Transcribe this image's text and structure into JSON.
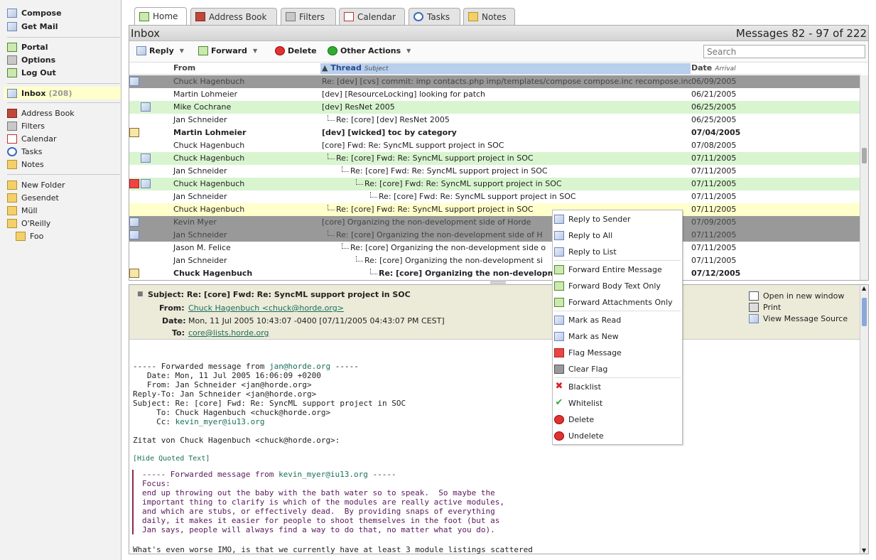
{
  "sidebar": {
    "compose": "Compose",
    "get_mail": "Get Mail",
    "portal": "Portal",
    "options": "Options",
    "logout": "Log Out",
    "inbox": "Inbox",
    "inbox_count": "(208)",
    "address_book": "Address Book",
    "filters": "Filters",
    "calendar": "Calendar",
    "tasks": "Tasks",
    "notes": "Notes",
    "new_folder": "New Folder",
    "folders": [
      "Gesendet",
      "Müll",
      "O'Reilly"
    ],
    "subfolder": "Foo"
  },
  "tabs": [
    "Home",
    "Address Book",
    "Filters",
    "Calendar",
    "Tasks",
    "Notes"
  ],
  "mailbox": {
    "title": "Inbox",
    "counter": "Messages 82 - 97 of 222",
    "search_placeholder": "Search"
  },
  "toolbar": {
    "reply": "Reply",
    "forward": "Forward",
    "delete": "Delete",
    "other_actions": "Other Actions"
  },
  "columns": {
    "from": "From",
    "thread": "Thread",
    "thread_sub": "Subject",
    "date": "Date",
    "date_sub": "Arrival"
  },
  "messages": [
    {
      "from": "Chuck Hagenbuch",
      "subject": "Re: [dev] [cvs] commit: imp contacts.php imp/templates/compose compose.inc recompose.inc",
      "date": "06/09/2005",
      "style": "deleted"
    },
    {
      "from": "Martin Lohmeier",
      "subject": "[dev] [ResourceLocking] looking for patch",
      "date": "06/21/2005",
      "style": ""
    },
    {
      "from": "Mike Cochrane",
      "subject": "[dev] ResNet 2005",
      "date": "06/25/2005",
      "style": "green"
    },
    {
      "from": "Jan Schneider",
      "subject": "Re: [core] [dev] ResNet 2005",
      "date": "06/25/2005",
      "style": ""
    },
    {
      "from": "Martin Lohmeier",
      "subject": "[dev] [wicked] toc by category",
      "date": "07/04/2005",
      "style": "unread"
    },
    {
      "from": "Chuck Hagenbuch",
      "subject": "[core] Fwd: Re: SyncML support project in SOC",
      "date": "07/08/2005",
      "style": ""
    },
    {
      "from": "Chuck Hagenbuch",
      "subject": "Re: [core] Fwd: Re: SyncML support project in SOC",
      "date": "07/11/2005",
      "style": "green"
    },
    {
      "from": "Jan Schneider",
      "subject": "Re: [core] Fwd: Re: SyncML support project in SOC",
      "date": "07/11/2005",
      "style": ""
    },
    {
      "from": "Chuck Hagenbuch",
      "subject": "Re: [core] Fwd: Re: SyncML support project in SOC",
      "date": "07/11/2005",
      "style": "green"
    },
    {
      "from": "Jan Schneider",
      "subject": "Re: [core] Fwd: Re: SyncML support project in SOC",
      "date": "07/11/2005",
      "style": ""
    },
    {
      "from": "Chuck Hagenbuch",
      "subject": "Re: [core] Fwd: Re: SyncML support project in SOC",
      "date": "07/11/2005",
      "style": "yellow"
    },
    {
      "from": "Kevin Myer",
      "subject": "[core] Organizing the non-development side of Horde",
      "date": "07/09/2005",
      "style": "deleted"
    },
    {
      "from": "Jan Schneider",
      "subject": "Re: [core] Organizing the non-development side of H",
      "date": "07/11/2005",
      "style": "deleted"
    },
    {
      "from": "Jason M. Felice",
      "subject": "Re: [core] Organizing the non-development side o",
      "date": "07/11/2005",
      "style": ""
    },
    {
      "from": "Jan Schneider",
      "subject": "Re: [core] Organizing the non-development si",
      "date": "07/11/2005",
      "style": ""
    },
    {
      "from": "Chuck Hagenbuch",
      "subject": "Re: [core] Organizing the non-developme",
      "date": "07/12/2005",
      "style": "unread"
    }
  ],
  "preview": {
    "subject_label": "Subject:",
    "subject": "Re: [core] Fwd: Re: SyncML support project in SOC",
    "from_label": "From:",
    "from": "Chuck Hagenbuch <chuck@horde.org>",
    "date_label": "Date:",
    "date": "Mon, 11 Jul 2005 10:43:07 -0400 [07/11/2005 04:43:07 PM CEST]",
    "to_label": "To:",
    "to": "core@lists.horde.org",
    "open_new_window": "Open in new window",
    "print": "Print",
    "view_source": "View Message Source",
    "body_fwd_head": "----- Forwarded message from ",
    "body_fwd_addr": "jan@horde.org",
    "body_fwd_tail": " -----",
    "body_date": "   Date: Mon, 11 Jul 2005 16:06:09 +0200",
    "body_from": "   From: Jan Schneider <jan@horde.org>",
    "body_replyto": "Reply-To: Jan Schneider <jan@horde.org>",
    "body_subject": "Subject: Re: [core] Fwd: Re: SyncML support project in SOC",
    "body_to": "     To: Chuck Hagenbuch <chuck@horde.org>",
    "body_cc_label": "     Cc: ",
    "body_cc": "kevin_myer@iu13.org",
    "body_zitat": "Zitat von Chuck Hagenbuch <chuck@horde.org>:",
    "hide_quoted": "[Hide Quoted Text]",
    "quote_head": "----- Forwarded message from ",
    "quote_addr": "kevin_myer@iu13.org",
    "quote_tail": " -----",
    "quote_lines": [
      "Focus:",
      "end up throwing out the baby with the bath water so to speak.  So maybe the",
      "important thing to clarify is which of the modules are really active modules,",
      "and which are stubs, or effectively dead.  By providing snaps of everything",
      "daily, it makes it easier for people to shoot themselves in the foot (but as",
      "Jan says, people will always find a way to do that, no matter what you do)."
    ],
    "last_line": "What's even worse IMO, is that we currently have at least 3 module listings scattered"
  },
  "context_menu": [
    "Reply to Sender",
    "Reply to All",
    "Reply to List",
    "Forward Entire Message",
    "Forward Body Text Only",
    "Forward Attachments Only",
    "Mark as Read",
    "Mark as New",
    "Flag Message",
    "Clear Flag",
    "Blacklist",
    "Whitelist",
    "Delete",
    "Undelete"
  ]
}
